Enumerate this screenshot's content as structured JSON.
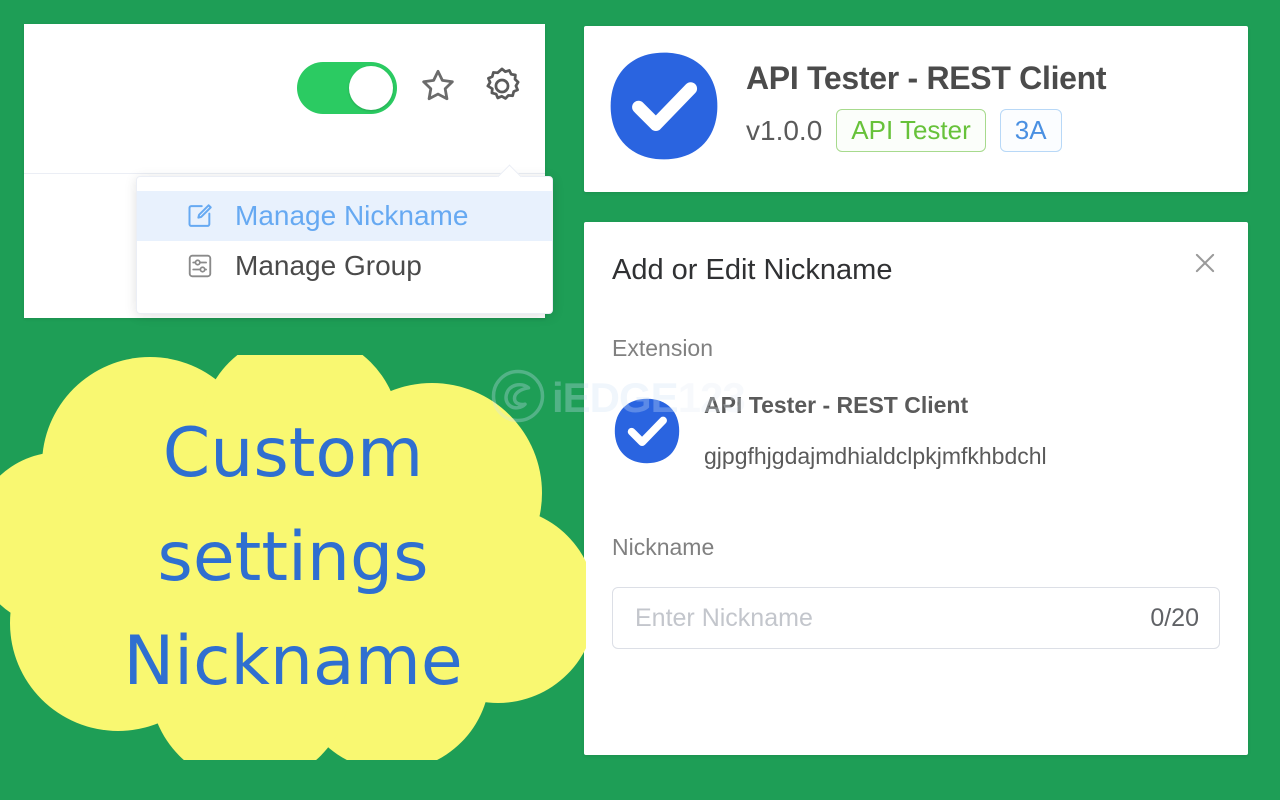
{
  "theme": {
    "background_green": "#1E9E56",
    "toggle_green": "#2BCB62",
    "accent_blue": "#4a90e2",
    "tag_green": "#67C23A",
    "cloud_yellow": "#F9F871",
    "cloud_text_blue": "#2f6fd0",
    "ext_logo_blue": "#2a64e0"
  },
  "watermark": {
    "logo": "edge-logo-icon",
    "text_primary": "iEDGE",
    "text_secondary": "123"
  },
  "popup": {
    "toolbar": {
      "toggle": {
        "name": "enable-extension-toggle",
        "state": "on"
      },
      "star_icon": "star-icon",
      "gear_icon": "gear-icon"
    },
    "dropdown": {
      "items": [
        {
          "label": "Manage Nickname",
          "icon": "edit-square-icon",
          "active": true
        },
        {
          "label": "Manage Group",
          "icon": "sliders-square-icon",
          "active": false
        }
      ]
    }
  },
  "header": {
    "logo_icon": "check-circle-icon",
    "title": "API Tester - REST Client",
    "version": "v1.0.0",
    "tags": [
      {
        "label": "API Tester",
        "style": "green"
      },
      {
        "label": "3A",
        "style": "blue"
      }
    ]
  },
  "dialog": {
    "title": "Add or Edit Nickname",
    "close_icon": "close-icon",
    "extension_label": "Extension",
    "extension": {
      "check_icon": "check-circle-icon",
      "name": "API Tester - REST Client",
      "id": "gjpgfhjgdajmdhialdclpkjmfkhbdchl"
    },
    "nickname_label": "Nickname",
    "nickname_value": "",
    "nickname_placeholder": "Enter Nickname",
    "counter": "0/20"
  },
  "callout": {
    "text": "Custom\nsettings\nNickname"
  }
}
